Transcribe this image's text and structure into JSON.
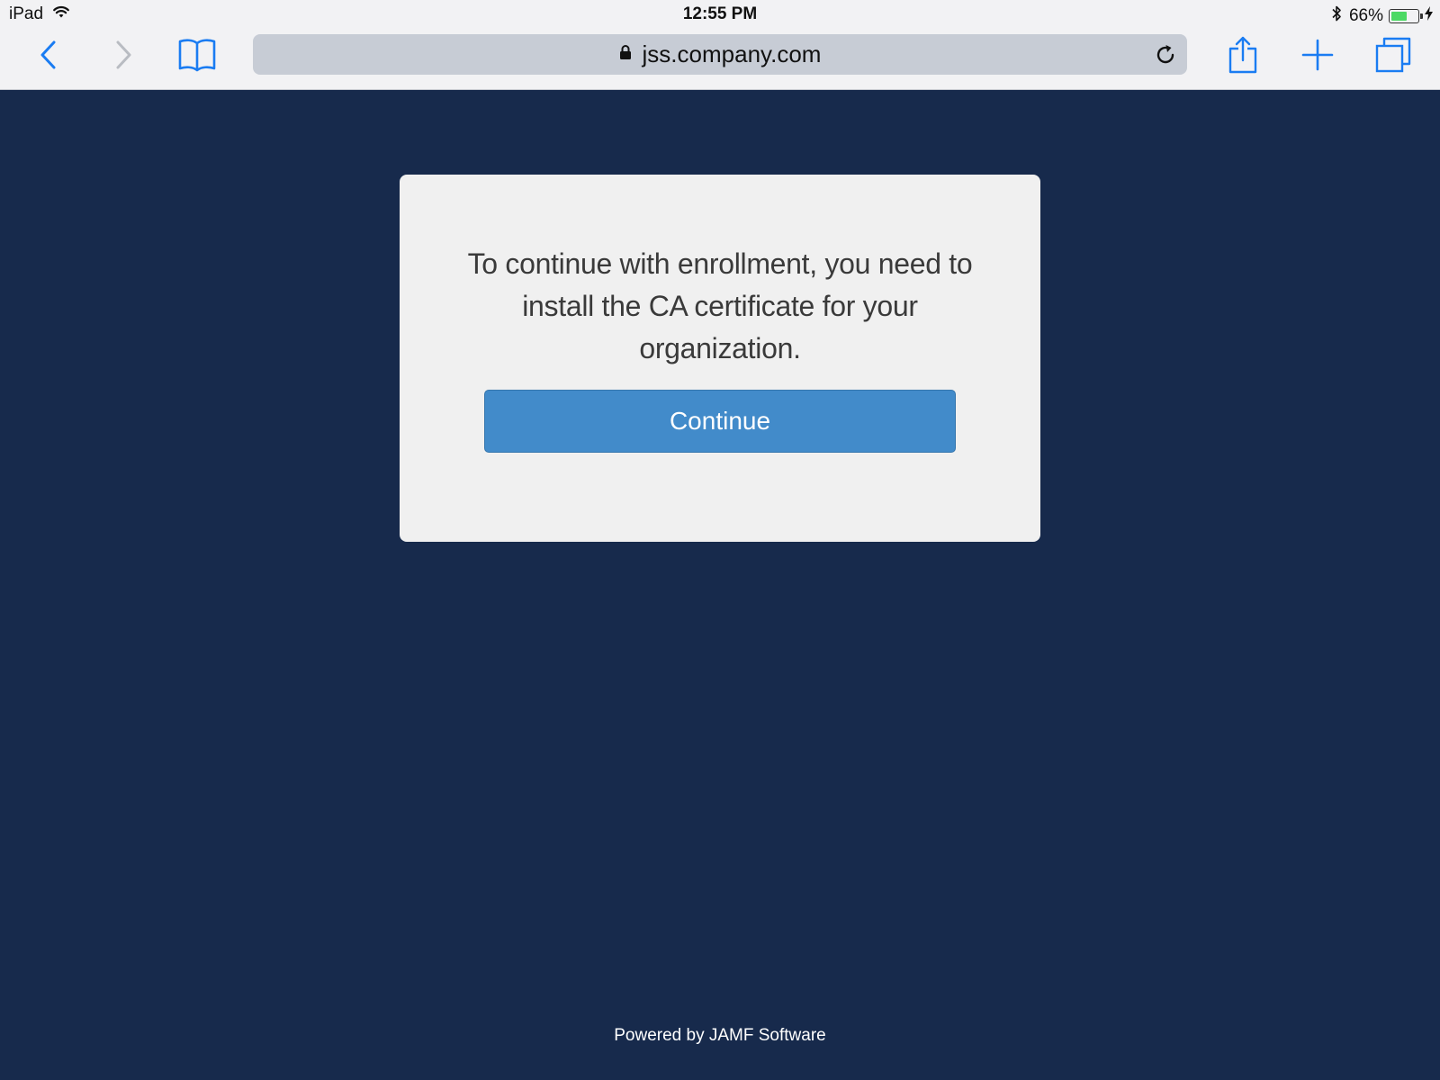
{
  "status_bar": {
    "device": "iPad",
    "time": "12:55 PM",
    "battery_percent": "66%",
    "battery_level": 0.66
  },
  "toolbar": {
    "url": "jss.company.com",
    "icons": {
      "back": "chevron-left-icon",
      "forward": "chevron-right-icon",
      "bookmarks": "book-icon",
      "lock": "lock-icon",
      "reload": "reload-icon",
      "share": "share-icon",
      "new_tab": "plus-icon",
      "tabs": "tabs-icon"
    },
    "accent_color": "#1a7cf2"
  },
  "page": {
    "message": "To continue with enrollment, you need to install the CA certificate for your organization.",
    "continue_label": "Continue",
    "footer": "Powered by JAMF Software",
    "background_color": "#172a4c",
    "button_color": "#428bca"
  }
}
